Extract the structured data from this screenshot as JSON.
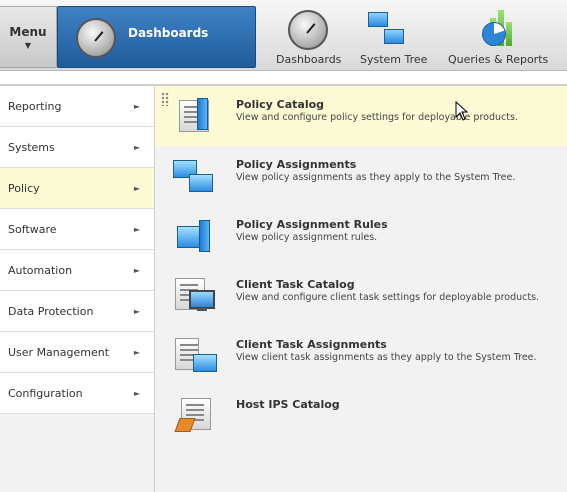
{
  "header": {
    "menu_label": "Menu",
    "menu_arrow": "▼",
    "active_tab_label": "Dashboards",
    "nav": [
      {
        "label": "Dashboards",
        "icon": "dashboard-gauge-icon"
      },
      {
        "label": "System Tree",
        "icon": "system-tree-icon"
      },
      {
        "label": "Queries & Reports",
        "icon": "queries-reports-chart-icon"
      }
    ]
  },
  "sidebar": {
    "items": [
      {
        "label": "Reporting",
        "arrow": "►"
      },
      {
        "label": "Systems",
        "arrow": "►"
      },
      {
        "label": "Policy",
        "arrow": "►",
        "active": true
      },
      {
        "label": "Software",
        "arrow": "►"
      },
      {
        "label": "Automation",
        "arrow": "►"
      },
      {
        "label": "Data Protection",
        "arrow": "►"
      },
      {
        "label": "User Management",
        "arrow": "►"
      },
      {
        "label": "Configuration",
        "arrow": "►"
      }
    ]
  },
  "content": {
    "items": [
      {
        "title": "Policy Catalog",
        "description": "View and configure policy settings for deployable products.",
        "icon": "policy-catalog-icon",
        "highlighted": true
      },
      {
        "title": "Policy Assignments",
        "description": "View policy assignments as they apply to the System Tree.",
        "icon": "policy-assignments-icon"
      },
      {
        "title": "Policy Assignment Rules",
        "description": "View policy assignment rules.",
        "icon": "policy-assignment-rules-icon"
      },
      {
        "title": "Client Task Catalog",
        "description": "View and configure client task settings for deployable products.",
        "icon": "client-task-catalog-icon"
      },
      {
        "title": "Client Task Assignments",
        "description": "View client task assignments as they apply to the System Tree.",
        "icon": "client-task-assignments-icon"
      },
      {
        "title": "Host IPS Catalog",
        "description": "",
        "icon": "host-ips-catalog-icon"
      }
    ]
  },
  "colors": {
    "active_tab": "#1f5c9c",
    "highlight": "#fdfbd6",
    "sidebar_active": "#fdfbd6"
  }
}
